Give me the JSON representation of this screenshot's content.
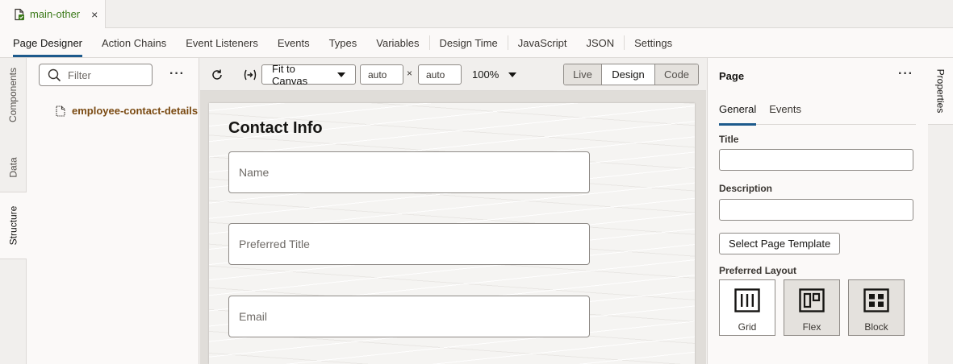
{
  "file_tab": {
    "name": "main-other",
    "close": "×"
  },
  "designer_tabs": [
    {
      "label": "Page Designer",
      "active": true
    },
    {
      "label": "Action Chains"
    },
    {
      "label": "Event Listeners"
    },
    {
      "label": "Events"
    },
    {
      "label": "Types"
    },
    {
      "label": "Variables"
    },
    {
      "label": "Design Time"
    },
    {
      "label": "JavaScript"
    },
    {
      "label": "JSON"
    },
    {
      "label": "Settings"
    }
  ],
  "left_rail": {
    "components": "Components",
    "data": "Data",
    "structure": "Structure"
  },
  "structure": {
    "filter_placeholder": "Filter",
    "more": "···",
    "tree_item": "employee-contact-details"
  },
  "toolbar": {
    "fit": "Fit to Canvas",
    "width": "auto",
    "times": "×",
    "height": "auto",
    "zoom": "100%",
    "modes": [
      "Live",
      "Design",
      "Code"
    ],
    "active_mode": "Design"
  },
  "canvas": {
    "title": "Contact Info",
    "fields": [
      "Name",
      "Preferred Title",
      "Email"
    ]
  },
  "properties": {
    "title": "Page",
    "more": "···",
    "tabs": [
      "General",
      "Events"
    ],
    "title_label": "Title",
    "description_label": "Description",
    "template_button": "Select Page Template",
    "layout_label": "Preferred Layout",
    "layouts": [
      "Grid",
      "Flex",
      "Block"
    ],
    "rail_label": "Properties"
  },
  "colors": {
    "accent": "#1d5a8c",
    "file_name": "#3c7a1a",
    "tree_item": "#7a4a12"
  }
}
